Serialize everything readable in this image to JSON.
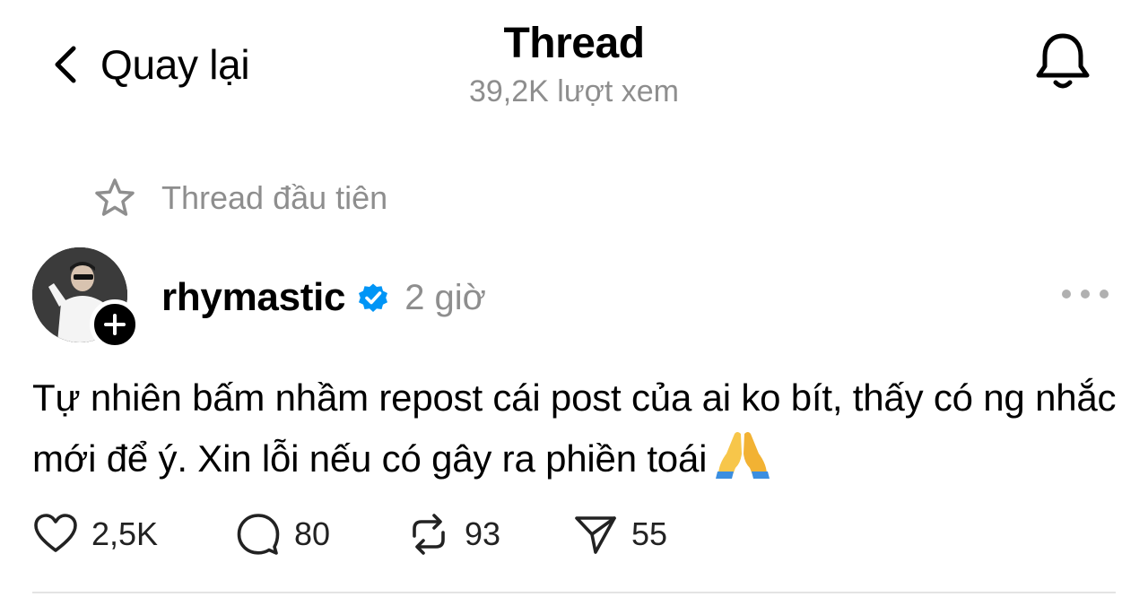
{
  "header": {
    "back_label": "Quay lại",
    "title": "Thread",
    "views": "39,2K lượt xem",
    "back_icon": "chevron-left-icon",
    "bell_icon": "bell-icon"
  },
  "pinned": {
    "label": "Thread đầu tiên",
    "icon": "star-icon"
  },
  "post": {
    "username": "rhymastic",
    "verified": true,
    "time": "2 giờ",
    "text": "Tự nhiên bấm nhầm repost cái post của ai ko bít, thấy có ng nhắc mới để ý. Xin lỗi nếu có gây ra phiền toái",
    "emoji": "folded-hands-emoji"
  },
  "actions": {
    "likes": "2,5K",
    "replies": "80",
    "reposts": "93",
    "shares": "55"
  },
  "colors": {
    "accent_verified": "#0095f6",
    "muted_text": "#8e8e8e"
  }
}
